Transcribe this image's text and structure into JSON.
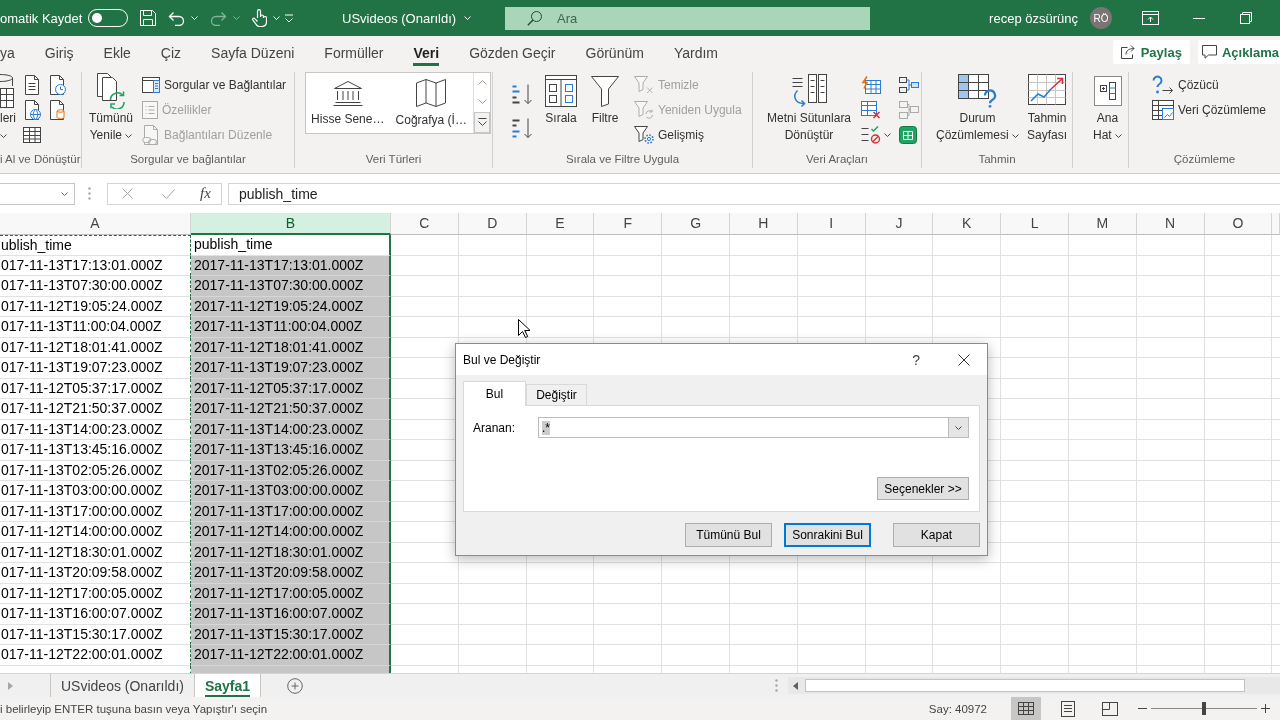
{
  "title_bar": {
    "autosave": {
      "label": "omatik Kaydet",
      "on": false
    },
    "quick_access": [
      {
        "disabled": false,
        "caret": false
      },
      {
        "disabled": false,
        "caret": true
      },
      {
        "disabled": true,
        "caret": true
      },
      {
        "disabled": false,
        "caret": true
      }
    ],
    "file_title": "USvideos (Onarıldı)",
    "search": {
      "placeholder": "Ara"
    },
    "user_name": "recep özsürünç",
    "avatar_initials": "RÖ"
  },
  "ribbon_tabs": [
    {
      "label": "ya",
      "selected": false
    },
    {
      "label": "Giriş",
      "selected": false
    },
    {
      "label": "Ekle",
      "selected": false
    },
    {
      "label": "Çiz",
      "selected": false
    },
    {
      "label": "Sayfa Düzeni",
      "selected": false
    },
    {
      "label": "Formüller",
      "selected": false
    },
    {
      "label": "Veri",
      "selected": true
    },
    {
      "label": "Gözden Geçir",
      "selected": false
    },
    {
      "label": "Görünüm",
      "selected": false
    },
    {
      "label": "Yardım",
      "selected": false
    }
  ],
  "share_button": "Paylaş",
  "comments_button": "Açıklama",
  "ribbon_groups": [
    {
      "label": "i Al ve Dönüştür",
      "items": [
        {
          "kind": "large",
          "lines": [
            "leri"
          ],
          "caret": true
        },
        {
          "kind": "icon",
          "disabled": false
        },
        {
          "kind": "icon",
          "disabled": false
        },
        {
          "kind": "icon",
          "disabled": false
        },
        {
          "kind": "icon",
          "disabled": false
        },
        {
          "kind": "icon",
          "disabled": false
        }
      ]
    },
    {
      "label": "Sorgular ve bağlantılar",
      "items": [
        {
          "kind": "large",
          "lines": [
            "Tümünü",
            "Yenile"
          ],
          "caret": true
        },
        {
          "kind": "small",
          "label": "Sorgular ve Bağlantılar",
          "disabled": false
        },
        {
          "kind": "small",
          "label": "Özellikler",
          "disabled": true
        },
        {
          "kind": "small",
          "label": "Bağlantıları Düzenle",
          "disabled": true
        }
      ]
    },
    {
      "label": "Veri Türleri",
      "items": [
        {
          "kind": "gallery",
          "entries": [
            "Hisse Sene…",
            "Coğrafya (İ…"
          ]
        }
      ]
    },
    {
      "label": "Sırala ve Filtre Uygula",
      "items": [
        {
          "kind": "icon",
          "disabled": false
        },
        {
          "kind": "icon",
          "disabled": false
        },
        {
          "kind": "large",
          "lines": [
            "Sırala"
          ],
          "caret": false
        },
        {
          "kind": "large",
          "lines": [
            "Filtre"
          ],
          "caret": false
        },
        {
          "kind": "small",
          "label": "Temizle",
          "disabled": true
        },
        {
          "kind": "small",
          "label": "Yeniden Uygula",
          "disabled": true
        },
        {
          "kind": "small",
          "label": "Gelişmiş",
          "disabled": false
        }
      ]
    },
    {
      "label": "Veri Araçları",
      "items": [
        {
          "kind": "large",
          "lines": [
            "Metni Sütunlara",
            "Dönüştür"
          ],
          "caret": false
        },
        {
          "kind": "icon",
          "disabled": false
        },
        {
          "kind": "icon",
          "disabled": false
        },
        {
          "kind": "icon",
          "disabled": false,
          "caret": true
        },
        {
          "kind": "icon",
          "disabled": false
        },
        {
          "kind": "icon",
          "disabled": true
        },
        {
          "kind": "icon",
          "disabled": false
        }
      ]
    },
    {
      "label": "Tahmin",
      "items": [
        {
          "kind": "large",
          "lines": [
            "Durum",
            "Çözümlemesi"
          ],
          "caret": true
        },
        {
          "kind": "large",
          "lines": [
            "Tahmin",
            "Sayfası"
          ],
          "caret": false
        }
      ]
    },
    {
      "items": [
        {
          "kind": "large",
          "lines": [
            "Ana",
            "Hat"
          ],
          "caret": true
        }
      ]
    },
    {
      "label": "Çözümleme",
      "items": [
        {
          "kind": "small",
          "label": "Çözücü",
          "disabled": false
        },
        {
          "kind": "small",
          "label": "Veri Çözümleme",
          "disabled": false
        }
      ]
    }
  ],
  "formula_bar": {
    "function_label": "fx",
    "formula": "publish_time"
  },
  "sheet": {
    "columns": [
      {
        "label": "A",
        "selected": false,
        "copied": true
      },
      {
        "label": "B",
        "selected": true,
        "copied": false
      },
      {
        "label": "C",
        "selected": false,
        "copied": false
      },
      {
        "label": "D",
        "selected": false,
        "copied": false
      },
      {
        "label": "E",
        "selected": false,
        "copied": false
      },
      {
        "label": "F",
        "selected": false,
        "copied": false
      },
      {
        "label": "G",
        "selected": false,
        "copied": false
      },
      {
        "label": "H",
        "selected": false,
        "copied": false
      },
      {
        "label": "I",
        "selected": false,
        "copied": false
      },
      {
        "label": "J",
        "selected": false,
        "copied": false
      },
      {
        "label": "K",
        "selected": false,
        "copied": false
      },
      {
        "label": "L",
        "selected": false,
        "copied": false
      },
      {
        "label": "M",
        "selected": false,
        "copied": false
      },
      {
        "label": "N",
        "selected": false,
        "copied": false
      },
      {
        "label": "O",
        "selected": false,
        "copied": false
      }
    ],
    "rows": [
      {
        "cells": [
          "ublish_time",
          "publish_time"
        ],
        "active": true
      },
      {
        "cells": [
          "017-11-13T17:13:01.000Z",
          "2017-11-13T17:13:01.000Z"
        ],
        "active": false
      },
      {
        "cells": [
          "017-11-13T07:30:00.000Z",
          "2017-11-13T07:30:00.000Z"
        ],
        "active": false
      },
      {
        "cells": [
          "017-11-12T19:05:24.000Z",
          "2017-11-12T19:05:24.000Z"
        ],
        "active": false
      },
      {
        "cells": [
          "017-11-13T11:00:04.000Z",
          "2017-11-13T11:00:04.000Z"
        ],
        "active": false
      },
      {
        "cells": [
          "017-11-12T18:01:41.000Z",
          "2017-11-12T18:01:41.000Z"
        ],
        "active": false
      },
      {
        "cells": [
          "017-11-13T19:07:23.000Z",
          "2017-11-13T19:07:23.000Z"
        ],
        "active": false
      },
      {
        "cells": [
          "017-11-12T05:37:17.000Z",
          "2017-11-12T05:37:17.000Z"
        ],
        "active": false
      },
      {
        "cells": [
          "017-11-12T21:50:37.000Z",
          "2017-11-12T21:50:37.000Z"
        ],
        "active": false
      },
      {
        "cells": [
          "017-11-13T14:00:23.000Z",
          "2017-11-13T14:00:23.000Z"
        ],
        "active": false
      },
      {
        "cells": [
          "017-11-13T13:45:16.000Z",
          "2017-11-13T13:45:16.000Z"
        ],
        "active": false
      },
      {
        "cells": [
          "017-11-13T02:05:26.000Z",
          "2017-11-13T02:05:26.000Z"
        ],
        "active": false
      },
      {
        "cells": [
          "017-11-13T03:00:00.000Z",
          "2017-11-13T03:00:00.000Z"
        ],
        "active": false
      },
      {
        "cells": [
          "017-11-13T17:00:00.000Z",
          "2017-11-13T17:00:00.000Z"
        ],
        "active": false
      },
      {
        "cells": [
          "017-11-12T14:00:00.000Z",
          "2017-11-12T14:00:00.000Z"
        ],
        "active": false
      },
      {
        "cells": [
          "017-11-12T18:30:01.000Z",
          "2017-11-12T18:30:01.000Z"
        ],
        "active": false
      },
      {
        "cells": [
          "017-11-13T20:09:58.000Z",
          "2017-11-13T20:09:58.000Z"
        ],
        "active": false
      },
      {
        "cells": [
          "017-11-12T17:00:05.000Z",
          "2017-11-12T17:00:05.000Z"
        ],
        "active": false
      },
      {
        "cells": [
          "017-11-13T16:00:07.000Z",
          "2017-11-13T16:00:07.000Z"
        ],
        "active": false
      },
      {
        "cells": [
          "017-11-13T15:30:17.000Z",
          "2017-11-13T15:30:17.000Z"
        ],
        "active": false
      },
      {
        "cells": [
          "017-11-12T22:00:01.000Z",
          "2017-11-12T22:00:01.000Z"
        ],
        "active": false
      }
    ]
  },
  "sheet_tabs": [
    {
      "label": "USvideos (Onarıldı)",
      "selected": false
    },
    {
      "label": "Sayfa1",
      "selected": true
    }
  ],
  "status_bar": {
    "message": "i belirleyip ENTER tuşuna basın veya Yapıştır'ı seçin",
    "count": "Say: 40972",
    "views": [
      {
        "selected": true
      },
      {
        "selected": false
      },
      {
        "selected": false
      }
    ],
    "zoom": {
      "level": 0.5
    }
  },
  "find_dialog": {
    "title": "Bul ve Değiştir",
    "help": "?",
    "tabs": [
      {
        "label": "Bul",
        "selected": true
      },
      {
        "label": "Değiştir",
        "selected": false
      }
    ],
    "find_label": "Aranan:",
    "find_value": ".*",
    "value_selected": true,
    "options_button": "Seçenekler >>",
    "buttons": [
      {
        "label": "Tümünü Bul",
        "default": false
      },
      {
        "label": "Sonrakini Bul",
        "default": true
      },
      {
        "label": "Kapat",
        "default": false
      }
    ]
  }
}
